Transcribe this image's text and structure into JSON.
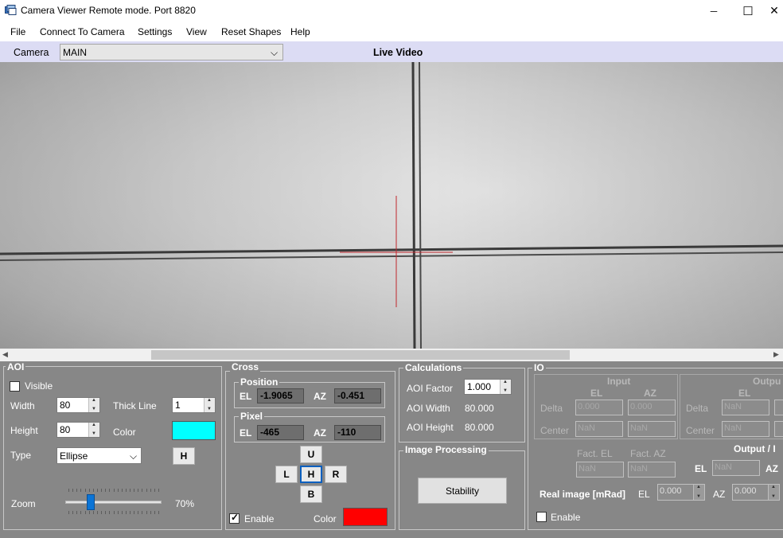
{
  "window": {
    "title": "Camera Viewer Remote mode. Port 8820",
    "minimize_glyph": "─",
    "maximize_glyph": "☐",
    "close_glyph": "✕"
  },
  "menu": [
    "File",
    "Connect To Camera",
    "Settings",
    "View",
    "Reset Shapes",
    "Help"
  ],
  "camera_bar": {
    "label": "Camera",
    "selected": "MAIN",
    "arrow_glyph": "⌵",
    "title": "Live Video"
  },
  "aoi": {
    "title": "AOI",
    "visible_label": "Visible",
    "visible_checked": false,
    "width_label": "Width",
    "width_value": "80",
    "height_label": "Height",
    "height_value": "80",
    "thick_line_label": "Thick Line",
    "thick_line_value": "1",
    "color_label": "Color",
    "color_value": "#00ffff",
    "type_label": "Type",
    "type_value": "Ellipse",
    "type_arrow": "⌵",
    "h_button": "H",
    "zoom_label": "Zoom",
    "zoom_value": "70%",
    "zoom_fraction": 0.22
  },
  "cross": {
    "title": "Cross",
    "position_title": "Position",
    "position_el_label": "EL",
    "position_el": "-1.9065",
    "position_az_label": "AZ",
    "position_az": "-0.451",
    "pixel_title": "Pixel",
    "pixel_el_label": "EL",
    "pixel_el": "-465",
    "pixel_az_label": "AZ",
    "pixel_az": "-110",
    "btn_up": "U",
    "btn_left": "L",
    "btn_home": "H",
    "btn_right": "R",
    "btn_bottom": "B",
    "enable_label": "Enable",
    "enable_checked": true,
    "check_glyph": "✓",
    "color_label": "Color",
    "color_value": "#ff0000"
  },
  "calculations": {
    "title": "Calculations",
    "aoi_factor_label": "AOI Factor",
    "aoi_factor_value": "1.000",
    "aoi_width_label": "AOI Width",
    "aoi_width_value": "80.000",
    "aoi_height_label": "AOI Height",
    "aoi_height_value": "80.000"
  },
  "image_processing": {
    "title": "Image Processing",
    "stability_button": "Stability"
  },
  "io": {
    "title": "IO",
    "input_title": "Input",
    "input_el_header": "EL",
    "input_az_header": "AZ",
    "delta_label": "Delta",
    "center_label": "Center",
    "input_delta_el": "0.000",
    "input_delta_az": "0.000",
    "input_center_el": "NaN",
    "input_center_az": "NaN",
    "output_title": "Outpu",
    "output_el_header": "EL",
    "output_delta_label": "Delta",
    "output_center_label": "Center",
    "output_delta_el": "NaN",
    "output_center_el": "NaN",
    "fact_el_label": "Fact. EL",
    "fact_az_label": "Fact. AZ",
    "fact_el_value": "NaN",
    "fact_az_value": "NaN",
    "output_i_title": "Output / I",
    "output_i_el_label": "EL",
    "output_i_el_value": "NaN",
    "output_i_az_label": "AZ",
    "real_image_label": "Real image [mRad]",
    "real_el_label": "EL",
    "real_el_value": "0.000",
    "real_az_label": "AZ",
    "real_az_value": "0.000",
    "enable_label": "Enable",
    "enable_checked": false
  },
  "colors": {
    "panel_bg": "#878787",
    "camera_bar_bg": "#dcdcf4",
    "crosshair": "#c0272d"
  }
}
